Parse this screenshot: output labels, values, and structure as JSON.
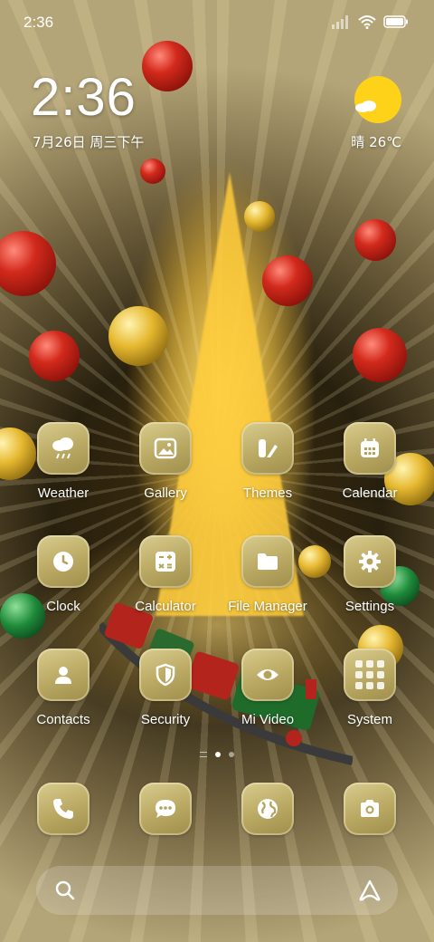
{
  "status_bar": {
    "time": "2:36"
  },
  "clock_widget": {
    "time": "2:36",
    "date": "7月26日 周三下午"
  },
  "weather_widget": {
    "condition": "晴",
    "temperature": "26℃"
  },
  "apps_row1": [
    {
      "label": "Weather",
      "icon": "cloud-rain-icon"
    },
    {
      "label": "Gallery",
      "icon": "image-icon"
    },
    {
      "label": "Themes",
      "icon": "themes-icon"
    },
    {
      "label": "Calendar",
      "icon": "calendar-icon"
    }
  ],
  "apps_row2": [
    {
      "label": "Clock",
      "icon": "clock-icon"
    },
    {
      "label": "Calculator",
      "icon": "calculator-icon"
    },
    {
      "label": "File Manager",
      "icon": "folder-icon"
    },
    {
      "label": "Settings",
      "icon": "gear-icon"
    }
  ],
  "apps_row3": [
    {
      "label": "Contacts",
      "icon": "person-icon"
    },
    {
      "label": "Security",
      "icon": "shield-icon"
    },
    {
      "label": "Mi Video",
      "icon": "eye-icon"
    },
    {
      "label": "System",
      "icon": "folder-grid-icon"
    }
  ],
  "dock": [
    {
      "icon": "phone-icon"
    },
    {
      "icon": "message-icon"
    },
    {
      "icon": "globe-icon"
    },
    {
      "icon": "camera-icon"
    }
  ],
  "search_bar": {
    "left_icon": "search-icon",
    "right_icon": "assistant-icon"
  },
  "theme": {
    "icon_bg": "#c2b26c",
    "accent_sun": "#ffd21a"
  }
}
